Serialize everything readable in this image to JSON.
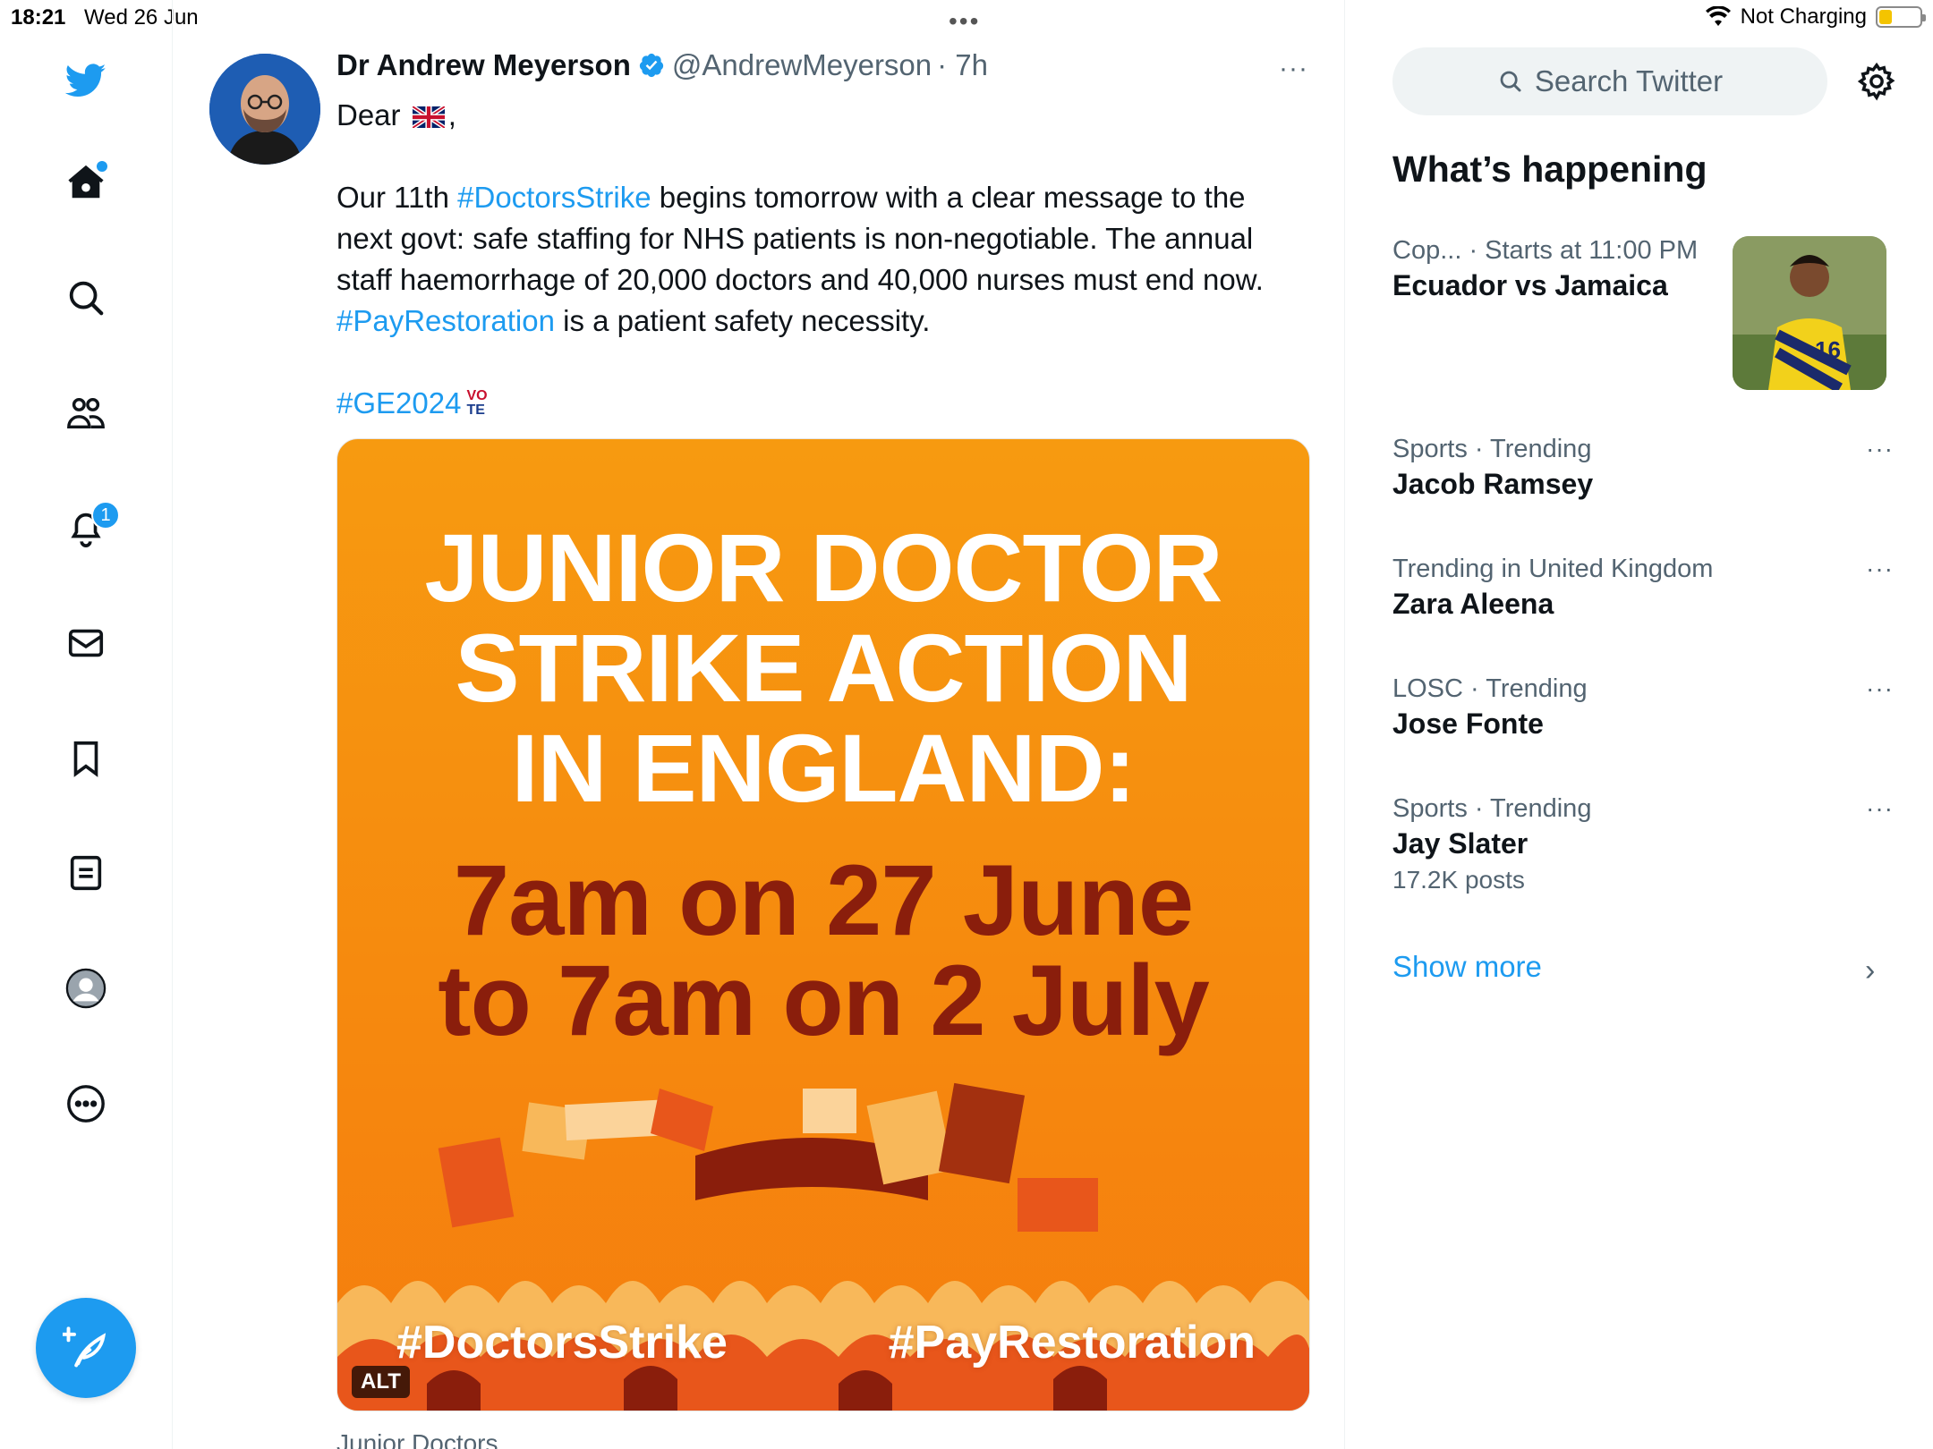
{
  "status_bar": {
    "time": "18:21",
    "date": "Wed 26 Jun",
    "battery_text": "Not Charging"
  },
  "nav": {
    "items": [
      {
        "name": "twitter-logo"
      },
      {
        "name": "home"
      },
      {
        "name": "explore"
      },
      {
        "name": "communities"
      },
      {
        "name": "notifications",
        "badge": "1"
      },
      {
        "name": "messages"
      },
      {
        "name": "bookmarks"
      },
      {
        "name": "lists"
      },
      {
        "name": "profile"
      },
      {
        "name": "more"
      }
    ],
    "compose_icon": "feather-plus-icon"
  },
  "tweet": {
    "author_name": "Dr Andrew Meyerson",
    "handle": "@AndrewMeyerson",
    "time": "· 7h",
    "greeting": "Dear",
    "greeting_suffix": ",",
    "para1_a": "Our 11th ",
    "para1_tag1": "#DoctorsStrike",
    "para1_b": " begins tomorrow with a clear message to the next govt: safe staffing for NHS patients is non-negotiable. The annual staff haemorrhage of 20,000 doctors and 40,000 nurses must end now. ",
    "para1_tag2": "#PayRestoration",
    "para1_c": " is a patient safety necessity.",
    "tag3": "#GE2024",
    "vote_badge_top": "VO",
    "vote_badge_bottom": "TE",
    "more": "···"
  },
  "media": {
    "title_lines": [
      "JUNIOR DOCTOR",
      "STRIKE ACTION",
      "IN ENGLAND:"
    ],
    "date_lines": [
      "7am on 27 June",
      "to 7am on 2 July"
    ],
    "tag_left": "#DoctorsStrike",
    "tag_right": "#PayRestoration",
    "alt_label": "ALT",
    "caption": "Junior Doctors"
  },
  "sidebar": {
    "search_placeholder": "Search Twitter",
    "section_title": "What’s happening",
    "featured": {
      "category": "Cop...",
      "meta": "· Starts at 11:00 PM",
      "title": "Ecuador vs Jamaica"
    },
    "trends": [
      {
        "meta": "Sports · Trending",
        "title": "Jacob Ramsey",
        "sub": ""
      },
      {
        "meta": "Trending in United Kingdom",
        "title": "Zara Aleena",
        "sub": ""
      },
      {
        "meta": "LOSC · Trending",
        "title": "Jose Fonte",
        "sub": ""
      },
      {
        "meta": "Sports · Trending",
        "title": "Jay Slater",
        "sub": "17.2K posts"
      }
    ],
    "trend_more": "···",
    "show_more": "Show more"
  },
  "colors": {
    "accent": "#1d9bf0",
    "text": "#0f1419",
    "secondary": "#536471",
    "poster_orange": "#f79a10",
    "poster_dark": "#8a1e0c"
  }
}
